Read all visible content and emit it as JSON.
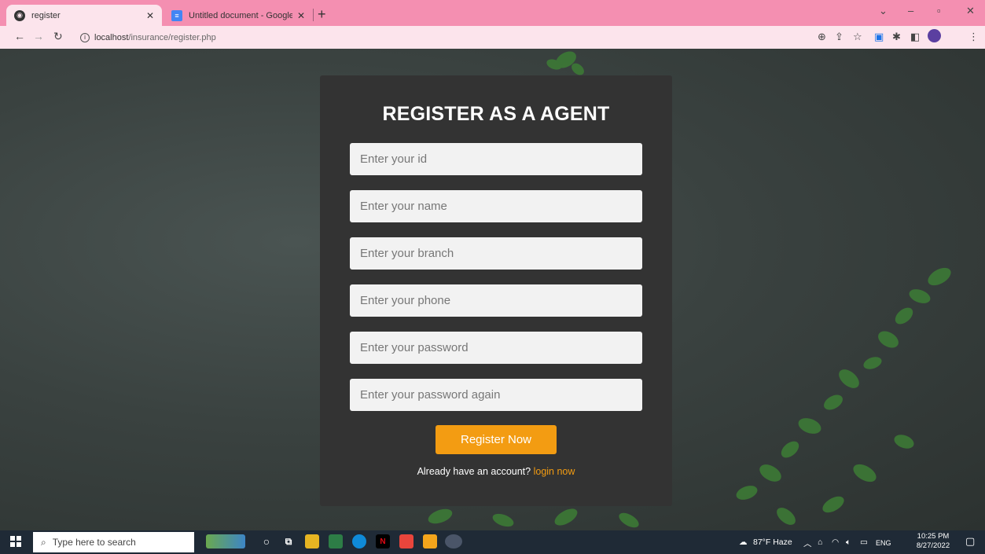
{
  "browser": {
    "tabs": [
      {
        "label": "register",
        "icon": "globe-icon"
      },
      {
        "label": "Untitled document - Google Doc",
        "icon": "docs-icon"
      }
    ],
    "new_tab": "+",
    "url_host": "localhost",
    "url_path": "/insurance/register.php",
    "window_controls": {
      "dropdown": "⌄",
      "minimize": "–",
      "maximize": "▫",
      "close": "✕"
    }
  },
  "form": {
    "title": "REGISTER AS A AGENT",
    "fields": [
      {
        "placeholder": "Enter your id"
      },
      {
        "placeholder": "Enter your name"
      },
      {
        "placeholder": "Enter your branch"
      },
      {
        "placeholder": "Enter your phone"
      },
      {
        "placeholder": "Enter your password"
      },
      {
        "placeholder": "Enter your password again"
      }
    ],
    "submit_label": "Register Now",
    "alt_text": "Already have an account?",
    "alt_link": "login now",
    "accent_color": "#f39c12"
  },
  "taskbar": {
    "search_placeholder": "Type here to search",
    "weather": "87°F Haze",
    "language": "ENG",
    "time": "10:25 PM",
    "date": "8/27/2022"
  }
}
